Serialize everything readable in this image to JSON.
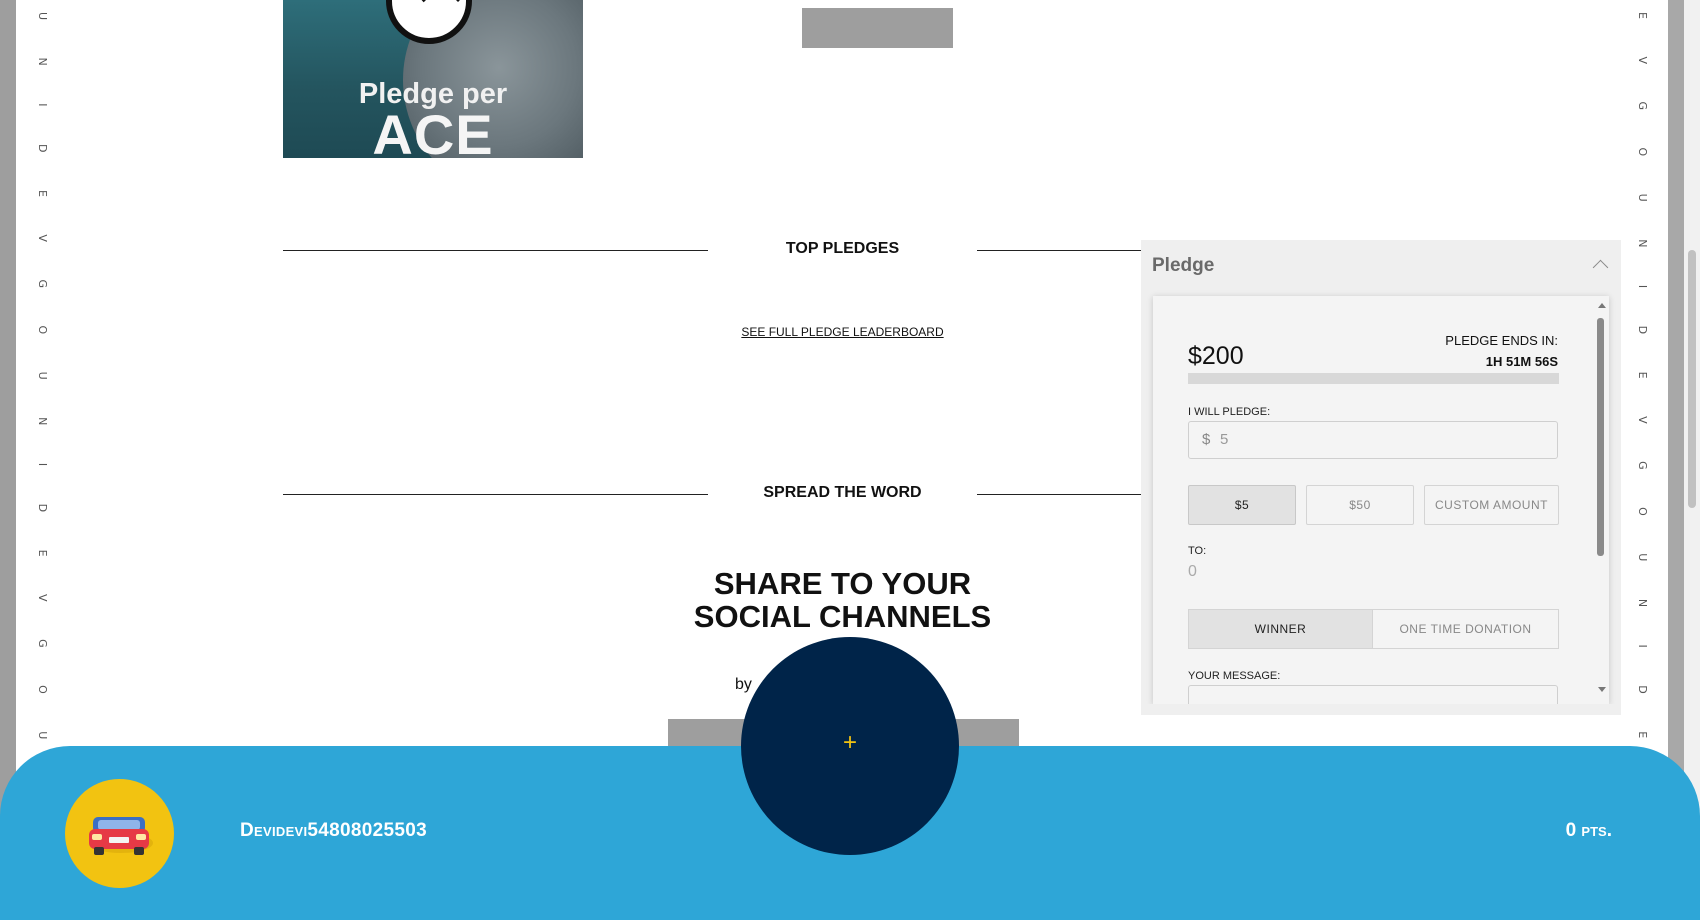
{
  "side_marquee": {
    "left_text": "U N I D E V G O U N I D E V G O U N I D E V G O U N I D E",
    "right_text": "E V G O U N I D E V G O U N I D E V G O U N I D E V G O"
  },
  "hero": {
    "line1": "Pledge per",
    "line2": "ACE"
  },
  "sections": {
    "top_pledges": "TOP PLEDGES",
    "leaderboard_link": "SEE FULL PLEDGE LEADERBOARD",
    "spread_word": "SPREAD THE WORD",
    "share_title_line1": "SHARE TO YOUR",
    "share_title_line2": "SOCIAL CHANNELS",
    "by_text": "by"
  },
  "pledge": {
    "header": "Pledge",
    "amount": "$200",
    "ends_label": "PLEDGE ENDS IN:",
    "ends_value": "1H 51M 56S",
    "progress_fraction": 0,
    "will_pledge_label": "I WILL PLEDGE:",
    "currency_symbol": "$",
    "input_value": "5",
    "amount_options": [
      {
        "label": "$5",
        "selected": true
      },
      {
        "label": "$50",
        "selected": false
      },
      {
        "label": "CUSTOM AMOUNT",
        "selected": false
      }
    ],
    "to_label": "TO:",
    "to_value": "0",
    "recipient_options": [
      {
        "label": "WINNER",
        "selected": true
      },
      {
        "label": "ONE TIME DONATION",
        "selected": false
      }
    ],
    "message_label": "YOUR MESSAGE:"
  },
  "bottom_bar": {
    "username": "Devidevi54808025503",
    "points": "0 pts.",
    "fab_symbol": "+",
    "avatar_icon": "car-icon",
    "colors": {
      "bar": "#2ea6d7",
      "avatar_bg": "#f2c311",
      "fab": "#002449",
      "fab_symbol": "#f2c311"
    }
  }
}
